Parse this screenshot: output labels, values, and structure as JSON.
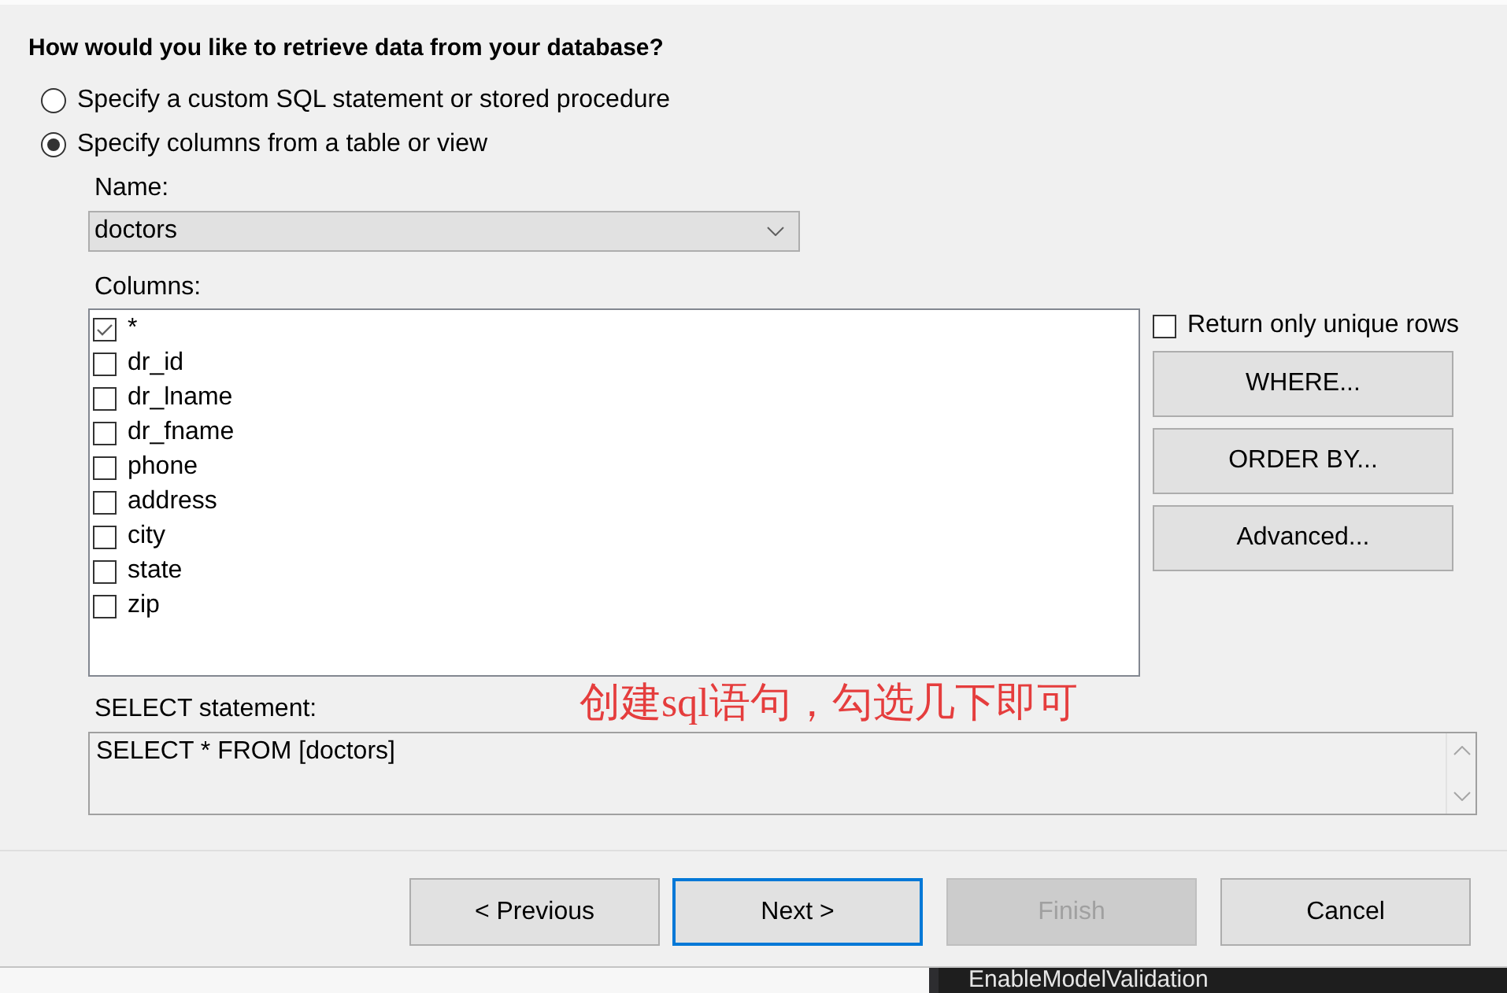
{
  "heading": "How would you like to retrieve data from your database?",
  "source_options": [
    {
      "label": "Specify a custom SQL statement or stored procedure",
      "selected": false
    },
    {
      "label": "Specify columns from a table or view",
      "selected": true
    }
  ],
  "table_name": {
    "label": "Name:",
    "value": "doctors"
  },
  "columns": {
    "label": "Columns:",
    "items": [
      {
        "name": "*",
        "checked": true
      },
      {
        "name": "dr_id",
        "checked": false
      },
      {
        "name": "dr_lname",
        "checked": false
      },
      {
        "name": "dr_fname",
        "checked": false
      },
      {
        "name": "phone",
        "checked": false
      },
      {
        "name": "address",
        "checked": false
      },
      {
        "name": "city",
        "checked": false
      },
      {
        "name": "state",
        "checked": false
      },
      {
        "name": "zip",
        "checked": false
      }
    ]
  },
  "unique_rows": {
    "label": "Return only unique rows",
    "checked": false
  },
  "clause_buttons": [
    "WHERE...",
    "ORDER BY...",
    "Advanced..."
  ],
  "annotation": "创建sql语句，勾选几下即可",
  "select_statement": {
    "label": "SELECT statement:",
    "value": "SELECT * FROM [doctors]"
  },
  "nav_buttons": [
    {
      "label": "< Previous",
      "focused": false,
      "disabled": false
    },
    {
      "label": "Next >",
      "focused": true,
      "disabled": false
    },
    {
      "label": "Finish",
      "focused": false,
      "disabled": true
    },
    {
      "label": "Cancel",
      "focused": false,
      "disabled": false
    }
  ],
  "editor": {
    "text": "EnableModelValidation"
  }
}
